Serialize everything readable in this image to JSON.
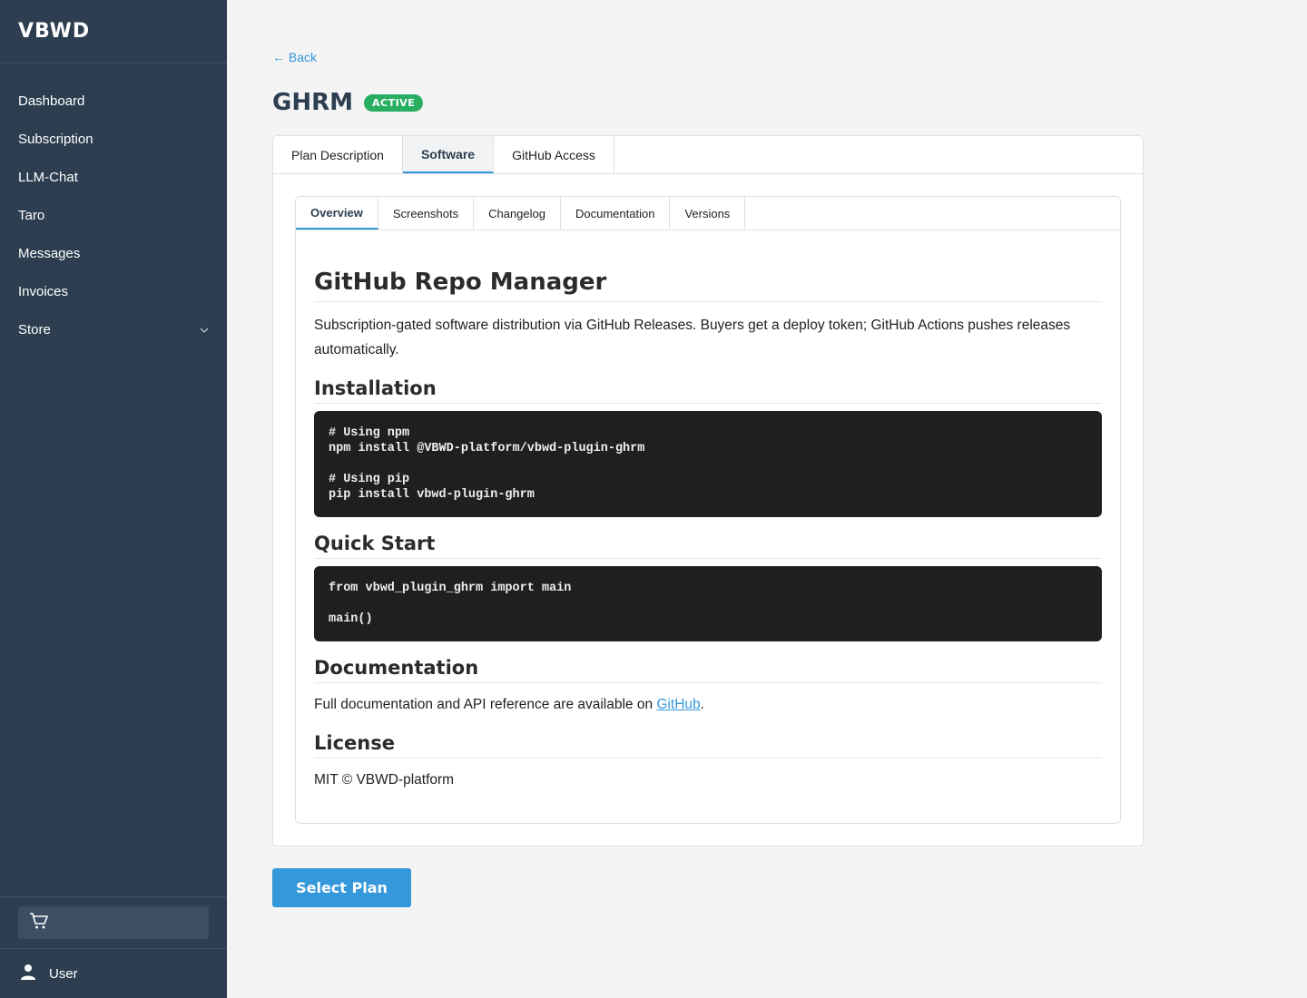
{
  "sidebar": {
    "brand": "VBWD",
    "items": [
      {
        "label": "Dashboard"
      },
      {
        "label": "Subscription"
      },
      {
        "label": "LLM-Chat"
      },
      {
        "label": "Taro"
      },
      {
        "label": "Messages"
      },
      {
        "label": "Invoices"
      },
      {
        "label": "Store"
      }
    ],
    "user_label": "User"
  },
  "header": {
    "back_label": "← Back",
    "title": "GHRM",
    "badge": "ACTIVE"
  },
  "outer_tabs": [
    {
      "label": "Plan Description"
    },
    {
      "label": "Software"
    },
    {
      "label": "GitHub Access"
    }
  ],
  "inner_tabs": [
    {
      "label": "Overview"
    },
    {
      "label": "Screenshots"
    },
    {
      "label": "Changelog"
    },
    {
      "label": "Documentation"
    },
    {
      "label": "Versions"
    }
  ],
  "content": {
    "title": "GitHub Repo Manager",
    "description": "Subscription-gated software distribution via GitHub Releases. Buyers get a deploy token; GitHub Actions pushes releases automatically.",
    "installation_heading": "Installation",
    "installation_code": "# Using npm\nnpm install @VBWD-platform/vbwd-plugin-ghrm\n\n# Using pip\npip install vbwd-plugin-ghrm",
    "quickstart_heading": "Quick Start",
    "quickstart_code": "from vbwd_plugin_ghrm import main\n\nmain()",
    "documentation_heading": "Documentation",
    "documentation_text_before": "Full documentation and API reference are available on ",
    "documentation_link": "GitHub",
    "documentation_text_after": ".",
    "license_heading": "License",
    "license_text": "MIT © VBWD-platform"
  },
  "actions": {
    "select_plan": "Select Plan"
  }
}
